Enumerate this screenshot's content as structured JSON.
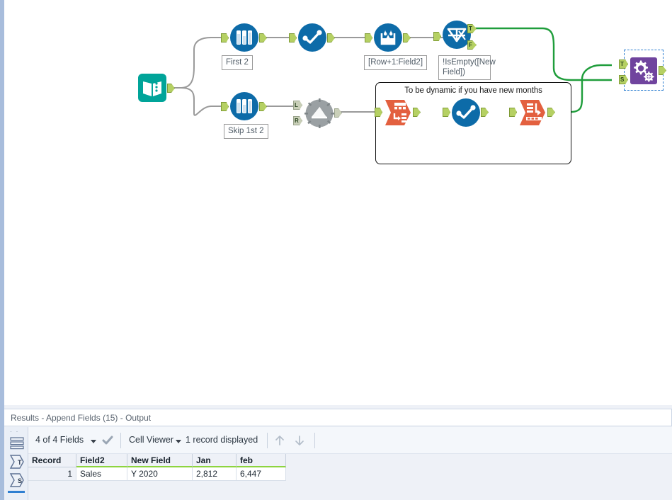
{
  "canvas": {
    "tools": [
      {
        "id": "input",
        "name": "input-data-tool",
        "label": null
      },
      {
        "id": "sample_top",
        "name": "sample-tool-first2",
        "label": "First 2"
      },
      {
        "id": "select_top",
        "name": "select-tool-top",
        "label": null
      },
      {
        "id": "multirow",
        "name": "multi-row-formula-tool",
        "label": "[Row+1:Field2]"
      },
      {
        "id": "filter",
        "name": "filter-tool",
        "label": "!IsEmpty([New Field])"
      },
      {
        "id": "sample_bot",
        "name": "sample-tool-skip1st2",
        "label": "Skip 1st 2"
      },
      {
        "id": "join",
        "name": "join-tool-disabled",
        "label": null
      },
      {
        "id": "transpose",
        "name": "transpose-tool",
        "label": null
      },
      {
        "id": "select_cont",
        "name": "select-tool-container",
        "label": null
      },
      {
        "id": "crosstab",
        "name": "cross-tab-tool",
        "label": null
      },
      {
        "id": "append",
        "name": "append-fields-tool",
        "label": null
      }
    ],
    "labels": {
      "first2": "First 2",
      "skip1st2": "Skip 1st 2",
      "multirow_expression": "[Row+1:Field2]",
      "filter_expression": "!IsEmpty([New Field])"
    },
    "container": {
      "caption": "To be dynamic if you have new months"
    },
    "anchors": {
      "true": "T",
      "false": "F",
      "left": "L",
      "right": "R",
      "target": "T",
      "source": "S"
    },
    "colors": {
      "input_tool": "#00a499",
      "blue_tool": "#0d6ba8",
      "orange_tool": "#e3603f",
      "purple_tool": "#70449e",
      "gray_tool": "#9aa0a3",
      "anchor_green": "#b5d063",
      "wire_gray": "#9a9a9a",
      "wire_green": "#1f9d3b",
      "selection_blue": "#2f7fd1"
    }
  },
  "results": {
    "title": "Results - Append Fields (15) - Output",
    "toolbar": {
      "fields_selector": "4 of 4 Fields",
      "viewer_selector": "Cell Viewer",
      "record_count": "1 record displayed",
      "check_icon": "check-icon",
      "up_icon": "arrow-up-icon",
      "down_icon": "arrow-down-icon"
    },
    "rail": {
      "records_icon": "records-list-icon",
      "t_anchor_icon": "sum-t-anchor-icon",
      "s_anchor_icon": "sum-s-anchor-icon"
    },
    "table": {
      "columns": [
        "Record",
        "Field2",
        "New Field",
        "Jan",
        "feb"
      ],
      "rows": [
        [
          "1",
          "Sales",
          "Y 2020",
          "2,812",
          "6,447"
        ]
      ]
    }
  }
}
